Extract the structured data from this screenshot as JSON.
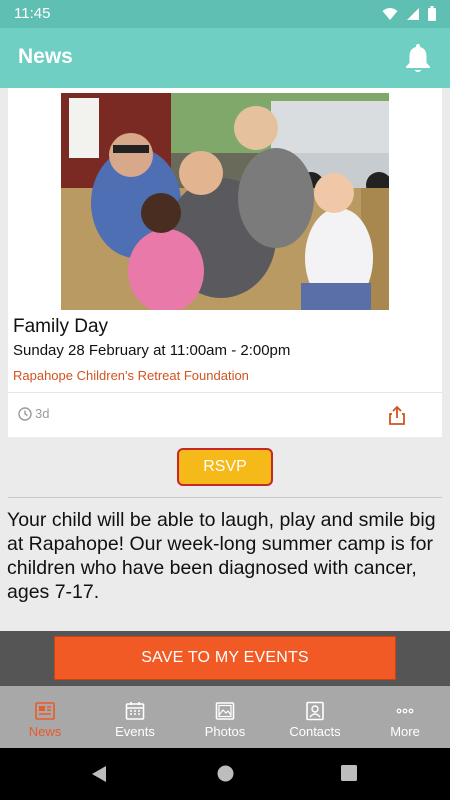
{
  "status_bar": {
    "time": "11:45"
  },
  "app_bar": {
    "title": "News",
    "bell_icon": "bell-icon"
  },
  "event": {
    "title": "Family Day",
    "datetime": "Sunday 28 February at 11:00am - 2:00pm",
    "organization": "Rapahope Children's Retreat Foundation",
    "age": "3d",
    "photo_icon": "event-photo"
  },
  "rsvp_label": "RSVP",
  "description": "Your child will be able to laugh, play and smile big at Rapahope! Our week-long summer camp is for children who have been diagnosed with cancer, ages 7-17.",
  "save_label": "SAVE TO MY EVENTS",
  "nav": {
    "items": [
      {
        "label": "News",
        "icon": "news-icon",
        "active": true
      },
      {
        "label": "Events",
        "icon": "calendar-icon",
        "active": false
      },
      {
        "label": "Photos",
        "icon": "photo-icon",
        "active": false
      },
      {
        "label": "Contacts",
        "icon": "contact-icon",
        "active": false
      },
      {
        "label": "More",
        "icon": "more-icon",
        "active": false
      }
    ]
  },
  "colors": {
    "header": "#6fcfc2",
    "accent": "#f15a24",
    "rsvp": "#f6b91a",
    "org_text": "#d0541f"
  }
}
